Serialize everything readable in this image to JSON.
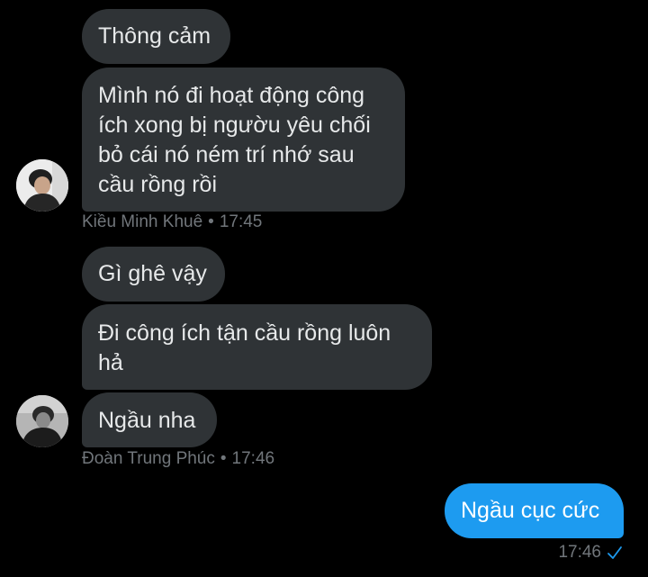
{
  "conversation": {
    "groups": [
      {
        "sender": "Kiều Minh Khuê",
        "time": "17:45",
        "messages": [
          "Thông cảm",
          "Mình nó đi hoạt động công\ních xong bị ngườu yêu chối\nbỏ cái nó ném trí nhớ sau\ncầu rồng rồi"
        ]
      },
      {
        "sender": "Đoàn Trung Phúc",
        "time": "17:46",
        "messages": [
          "Gì ghê vậy",
          "Đi công ích tận cầu rồng luôn\nhả",
          "Ngầu nha"
        ]
      },
      {
        "sender": "",
        "time": "17:46",
        "outgoing": true,
        "messages": [
          "Ngầu cục cức"
        ],
        "status_icon": "single-check-icon"
      }
    ]
  },
  "colors": {
    "background": "#000000",
    "incoming_bubble": "#2f3336",
    "outgoing_bubble": "#1d9bf0",
    "meta_text": "#71767b",
    "check": "#1d9bf0"
  }
}
